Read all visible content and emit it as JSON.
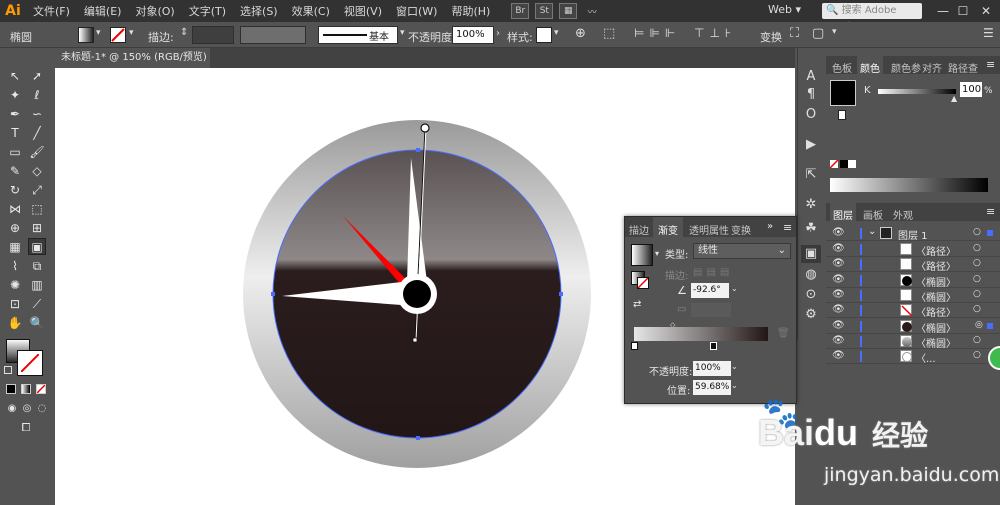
{
  "app": {
    "logo": "Ai"
  },
  "menu": [
    "文件(F)",
    "编辑(E)",
    "对象(O)",
    "文字(T)",
    "选择(S)",
    "效果(C)",
    "视图(V)",
    "窗口(W)",
    "帮助(H)"
  ],
  "menu_icons": {
    "bridge": "Br",
    "stock": "St"
  },
  "workspace": {
    "label": "Web"
  },
  "search": {
    "placeholder": "搜索 Adobe Stock"
  },
  "control": {
    "object_type": "椭圆",
    "stroke_label": "描边:",
    "stroke_style": "基本",
    "opacity_label": "不透明度:",
    "opacity_value": "100%",
    "style_label": "样式:",
    "transform_label": "变换"
  },
  "document": {
    "tab_title": "未标题-1* @ 150% (RGB/预览)"
  },
  "color_panel": {
    "tabs": [
      "色板",
      "颜色",
      "颜色参",
      "对齐",
      "路径查"
    ],
    "active_tab": "颜色",
    "channel": "K",
    "value": "100",
    "unit": "%"
  },
  "layers_panel": {
    "tabs": [
      "图层",
      "画板",
      "外观"
    ],
    "active_tab": "图层",
    "layer_name": "图层 1",
    "rows": [
      "〈路径〉",
      "〈路径〉",
      "〈椭圆〉",
      "〈椭圆〉",
      "〈路径〉",
      "〈椭圆〉",
      "〈椭圆〉",
      "〈..."
    ]
  },
  "gradient_panel": {
    "tabs": [
      "描边",
      "渐变",
      "透明",
      "属性",
      "变换"
    ],
    "active_tab": "渐变",
    "type_label": "类型:",
    "type_value": "线性",
    "stroke_label": "描边:",
    "angle_value": "-92.6°",
    "opacity_label": "不透明度:",
    "opacity_value": "100%",
    "location_label": "位置:",
    "location_value": "59.68%"
  },
  "watermark": {
    "brand": "Bai",
    "brand_cn": "经验",
    "url": "jingyan.baidu.com"
  },
  "colors": {
    "accent_red": "#ff0000",
    "clock_face": "#2a1a1a",
    "ring_light": "#e4e4e4",
    "ring_dark": "#9a9a9a",
    "selection_blue": "#4a6cff",
    "app_orange": "#ff9a00"
  }
}
